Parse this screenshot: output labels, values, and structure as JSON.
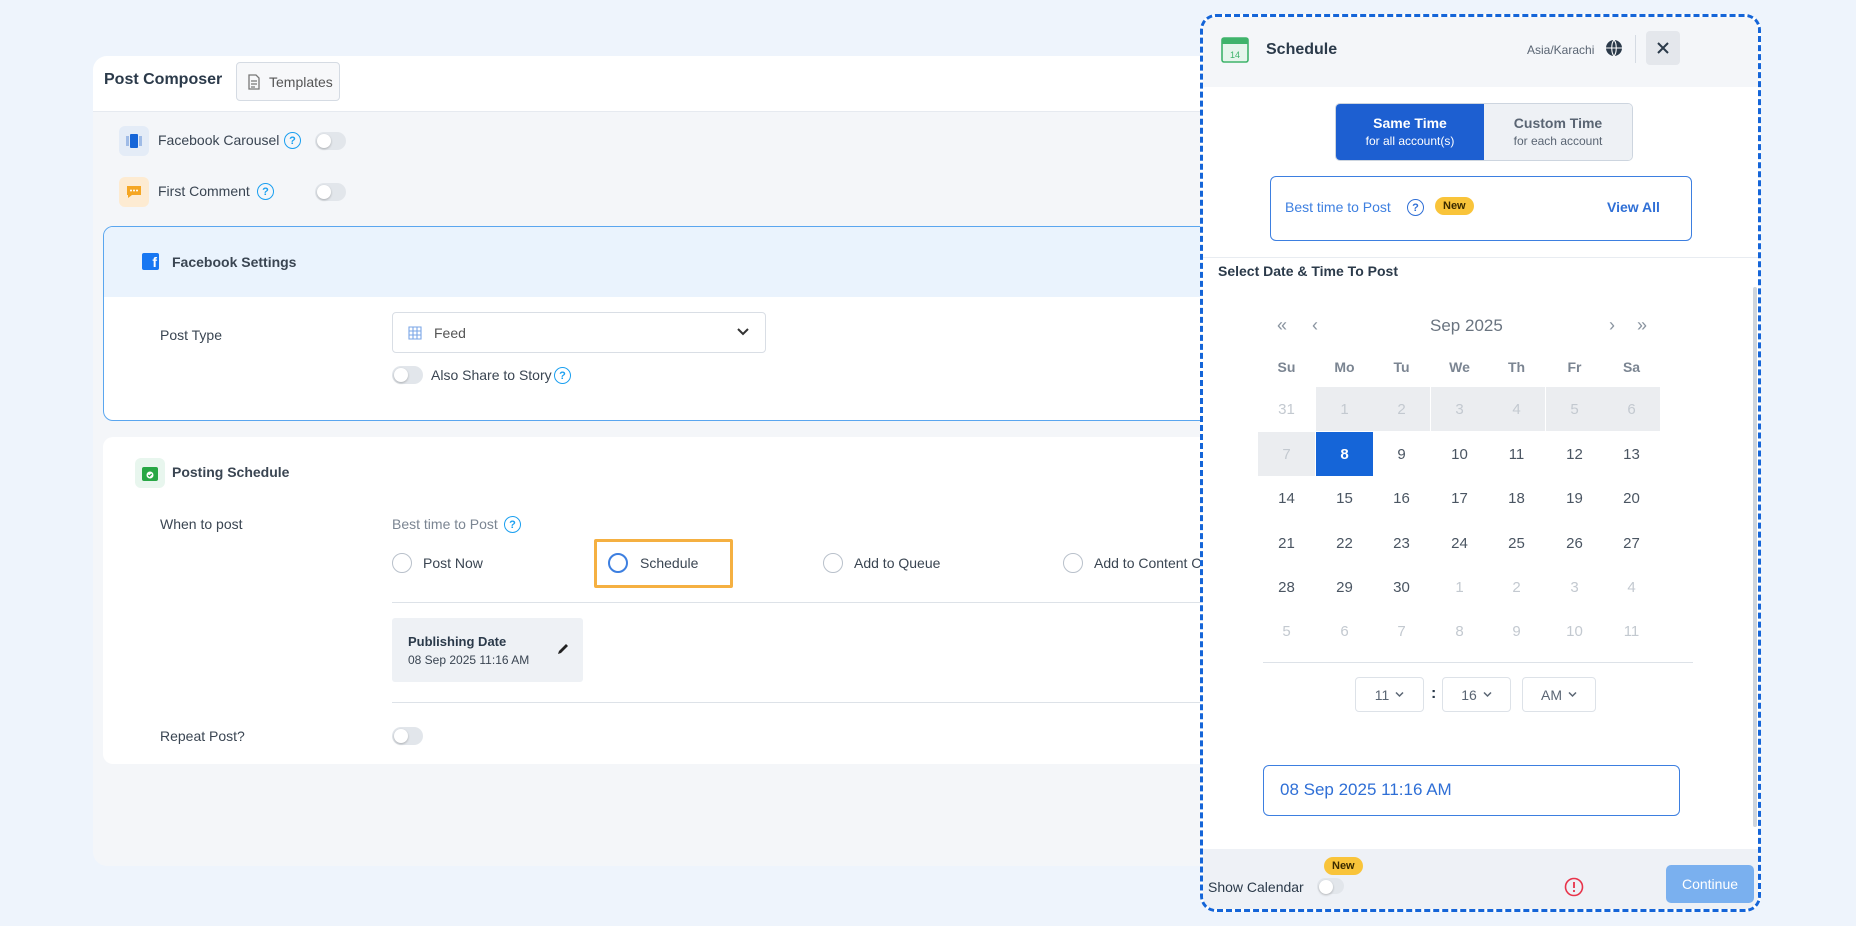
{
  "composer": {
    "title": "Post Composer",
    "templates_label": "Templates",
    "options": {
      "carousel_label": "Facebook Carousel",
      "first_comment_label": "First Comment"
    },
    "facebook_settings": {
      "title": "Facebook Settings",
      "post_type_label": "Post Type",
      "post_type_value": "Feed",
      "also_share_label": "Also Share to Story"
    },
    "posting_schedule": {
      "title": "Posting Schedule",
      "when_label": "When to post",
      "best_time_label": "Best time to Post",
      "radio_options": [
        "Post Now",
        "Schedule",
        "Add to Queue",
        "Add to Content C"
      ],
      "selected_option": "Schedule",
      "publishing_date_title": "Publishing Date",
      "publishing_date_value": "08 Sep 2025 11:16 AM",
      "repeat_label": "Repeat Post?"
    }
  },
  "modal": {
    "title": "Schedule",
    "timezone": "Asia/Karachi",
    "tabs": [
      {
        "title": "Same Time",
        "subtitle": "for all account(s)",
        "active": true
      },
      {
        "title": "Custom Time",
        "subtitle": "for each account",
        "active": false
      }
    ],
    "best_time": {
      "label": "Best time to Post",
      "badge": "New",
      "view_all": "View All"
    },
    "section_title": "Select Date & Time To Post",
    "calendar": {
      "month": "Sep",
      "year": "2025",
      "weekdays": [
        "Su",
        "Mo",
        "Tu",
        "We",
        "Th",
        "Fr",
        "Sa"
      ],
      "weeks": [
        [
          "31",
          "1",
          "2",
          "3",
          "4",
          "5",
          "6"
        ],
        [
          "7",
          "8",
          "9",
          "10",
          "11",
          "12",
          "13"
        ],
        [
          "14",
          "15",
          "16",
          "17",
          "18",
          "19",
          "20"
        ],
        [
          "21",
          "22",
          "23",
          "24",
          "25",
          "26",
          "27"
        ],
        [
          "28",
          "29",
          "30",
          "1",
          "2",
          "3",
          "4"
        ],
        [
          "5",
          "6",
          "7",
          "8",
          "9",
          "10",
          "11"
        ]
      ],
      "selected_day": "8"
    },
    "time": {
      "hour": "11",
      "separator": ":",
      "minute": "16",
      "meridiem": "AM"
    },
    "selected_datetime": "08 Sep 2025 11:16 AM",
    "footer": {
      "show_calendar_label": "Show Calendar",
      "badge": "New",
      "continue_label": "Continue"
    }
  },
  "colors": {
    "primary": "#1565d8",
    "accent_help": "#1a9ff0",
    "badge": "#f9c43a",
    "highlight": "#f5b041"
  }
}
